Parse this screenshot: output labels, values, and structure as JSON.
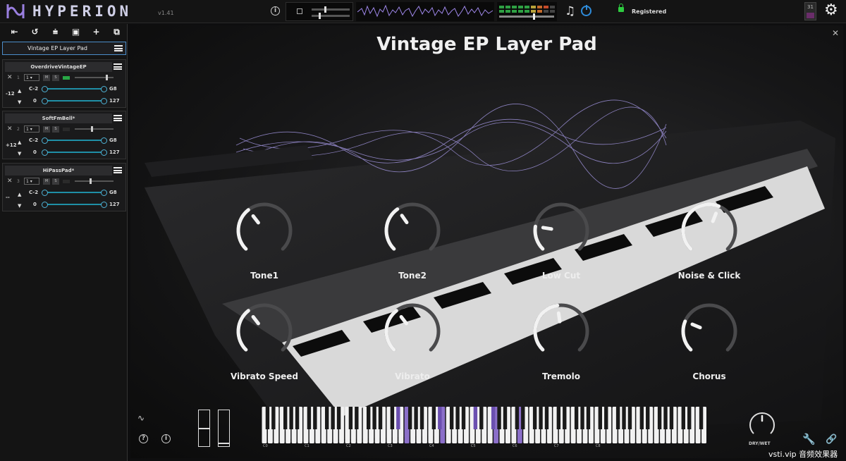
{
  "app": {
    "name": "HYPERION",
    "version": "v1.41",
    "registered_label": "Registered",
    "calendar_number": "31"
  },
  "sidebar": {
    "toolbar": [
      "first-icon",
      "reset-icon",
      "clean-icon",
      "save-icon",
      "add-icon",
      "duplicate-icon"
    ],
    "preset_name": "Vintage EP Layer Pad",
    "layers": [
      {
        "name": "OverdriveVintageEP",
        "index": "1",
        "channel": "1",
        "transpose": "-12",
        "key_low": "C-2",
        "key_high": "G8",
        "vel_low": "0",
        "vel_high": "127",
        "volume": 0.85,
        "led": true
      },
      {
        "name": "SoftFmBell*",
        "index": "2",
        "channel": "1",
        "transpose": "+12",
        "key_low": "C-2",
        "key_high": "G8",
        "vel_low": "0",
        "vel_high": "127",
        "volume": 0.45,
        "led": false
      },
      {
        "name": "HiPassPad*",
        "index": "3",
        "channel": "1",
        "transpose": "--",
        "key_low": "C-2",
        "key_high": "G8",
        "vel_low": "0",
        "vel_high": "127",
        "volume": 0.4,
        "led": false
      }
    ]
  },
  "main": {
    "title": "Vintage EP Layer Pad",
    "knobs": [
      {
        "label": "Tone1",
        "value": 0.36
      },
      {
        "label": "Tone2",
        "value": 0.37
      },
      {
        "label": "Low Cut",
        "value": 0.2
      },
      {
        "label": "Noise & Click",
        "value": 0.58
      },
      {
        "label": "Vibrato Speed",
        "value": 0.36
      },
      {
        "label": "Vibrato",
        "value": 0.36
      },
      {
        "label": "Tremolo",
        "value": 0.47
      },
      {
        "label": "Chorus",
        "value": 0.25
      }
    ],
    "keyboard": {
      "octave_labels": [
        "C0",
        "C1",
        "C2",
        "C3",
        "C4",
        "C5",
        "C6",
        "C7",
        "C8"
      ],
      "highlight_color": "#8b6fc9"
    },
    "drywet_label": "DRY/WET",
    "drywet_value": 0.5
  },
  "watermark": "vsti.vip 音频效果器",
  "colors": {
    "accent_blue": "#2e8bd9",
    "registered_green": "#2ecc40",
    "range_cyan": "#1f8fa6"
  }
}
